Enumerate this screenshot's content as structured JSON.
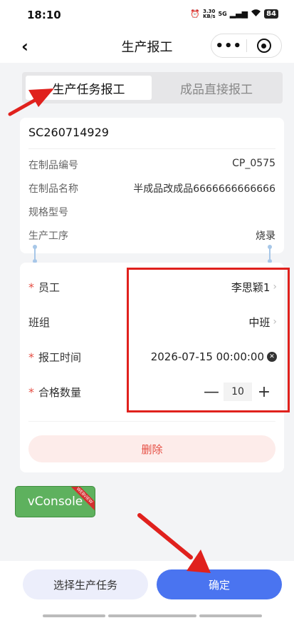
{
  "status_bar": {
    "time": "18:10",
    "alarm_icon": "alarm-icon",
    "net_speed_value": "3.30",
    "net_speed_unit": "KB/s",
    "network": "5G",
    "battery": "84"
  },
  "nav": {
    "title": "生产报工",
    "back_icon": "chevron-left-icon",
    "more_icon": "more-dots-icon",
    "close_icon": "target-circle-icon"
  },
  "tabs": [
    {
      "label": "生产任务报工",
      "active": true
    },
    {
      "label": "成品直接报工",
      "active": false
    }
  ],
  "task": {
    "order_no": "SC260714929",
    "rows": [
      {
        "label": "在制品编号",
        "value": "CP_0575"
      },
      {
        "label": "在制品名称",
        "value": "半成品改成品6666666666666"
      },
      {
        "label": "规格型号",
        "value": ""
      },
      {
        "label": "生产工序",
        "value": "烧录"
      }
    ]
  },
  "form": {
    "employee": {
      "label": "员工",
      "required": true,
      "value": "李思颖1"
    },
    "team": {
      "label": "班组",
      "required": false,
      "value": "中班"
    },
    "report_time": {
      "label": "报工时间",
      "required": true,
      "value": "2026-07-15 00:00:00"
    },
    "qualified_qty": {
      "label": "合格数量",
      "required": true,
      "value": "10",
      "minus": "—",
      "plus": "+"
    },
    "delete_label": "删除"
  },
  "vconsole": {
    "label": "vConsole",
    "tag": "WEBVIEW"
  },
  "footer": {
    "select_task_label": "选择生产任务",
    "confirm_label": "确定"
  },
  "colors": {
    "primary": "#4a74f0",
    "danger": "#e54d42",
    "annotation": "#e0211d",
    "vconsole": "#5eb15e"
  }
}
